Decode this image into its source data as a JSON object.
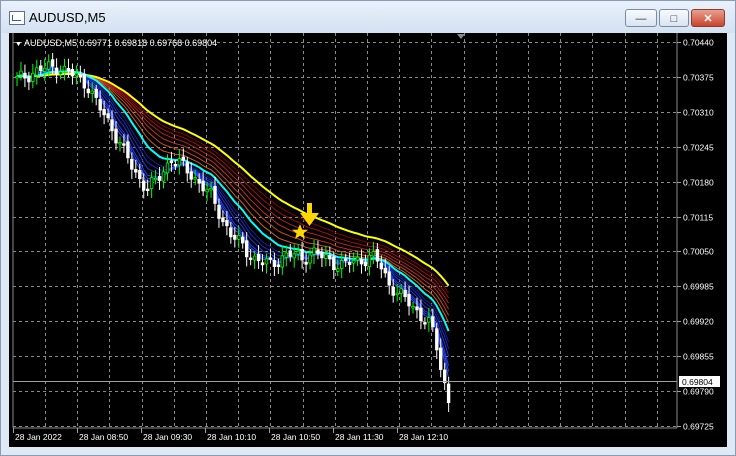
{
  "window": {
    "title": "AUDUSD,M5",
    "min_icon": "minimize-icon",
    "max_icon": "maximize-icon",
    "close_icon": "close-icon"
  },
  "chart": {
    "header": "AUDUSD,M5  0.69771 0.69818 0.69768 0.69804",
    "current_price": "0.69804",
    "colors": {
      "background": "#000000",
      "grid": "#8a8a8a",
      "bull": "#00ff00",
      "bear": "#ffffff",
      "ribbon_slow": "#ffff00",
      "ribbon_fast": "#00ffff",
      "ribbon_red": "#b22222",
      "ribbon_blue": "#1e3cff",
      "arrow": "#ffd700"
    },
    "annotation_icons": [
      "down-arrow-icon",
      "star-icon"
    ]
  },
  "chart_data": {
    "type": "candlestick",
    "symbol": "AUDUSD",
    "timeframe": "M5",
    "y_ticks": [
      "0.70440",
      "0.70375",
      "0.70310",
      "0.70245",
      "0.70180",
      "0.70115",
      "0.70050",
      "0.69985",
      "0.69920",
      "0.69855",
      "0.69790",
      "0.69725"
    ],
    "x_ticks": [
      "28 Jan 2022",
      "28 Jan 08:50",
      "28 Jan 09:30",
      "28 Jan 10:10",
      "28 Jan 10:50",
      "28 Jan 11:30",
      "28 Jan 12:10"
    ],
    "ylim": [
      0.69725,
      0.7044
    ],
    "last_bar": {
      "open": 0.69771,
      "high": 0.69818,
      "low": 0.69768,
      "close": 0.69804
    },
    "grid": true
  }
}
